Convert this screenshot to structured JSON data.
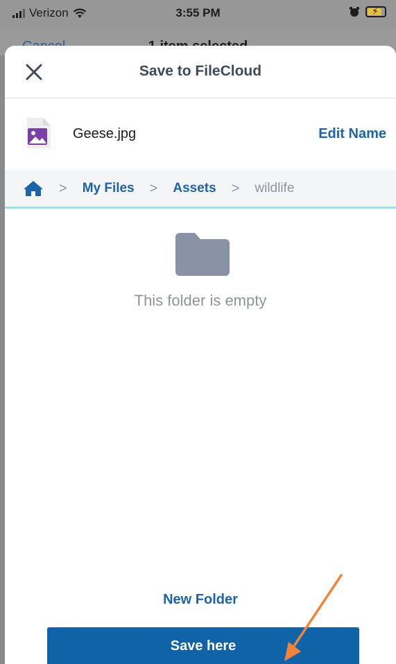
{
  "status_bar": {
    "carrier": "Verizon",
    "time": "3:55 PM"
  },
  "behind_sheet": {
    "cancel_label": "Cancel",
    "title": "1 item selected"
  },
  "header": {
    "title": "Save to FileCloud",
    "close_icon": "close-icon"
  },
  "file": {
    "name": "Geese.jpg",
    "icon": "image-file-icon",
    "edit_label": "Edit Name"
  },
  "breadcrumb": {
    "home_icon": "home-icon",
    "items": [
      "My Files",
      "Assets"
    ],
    "current": "wildlife",
    "separator": ">"
  },
  "empty_state": {
    "icon": "folder-icon",
    "message": "This folder is empty"
  },
  "actions": {
    "new_folder_label": "New Folder",
    "save_label": "Save here"
  },
  "colors": {
    "accent": "#1e63a8",
    "save_button": "#0f63a6",
    "annotation_arrow": "#f0843c"
  }
}
